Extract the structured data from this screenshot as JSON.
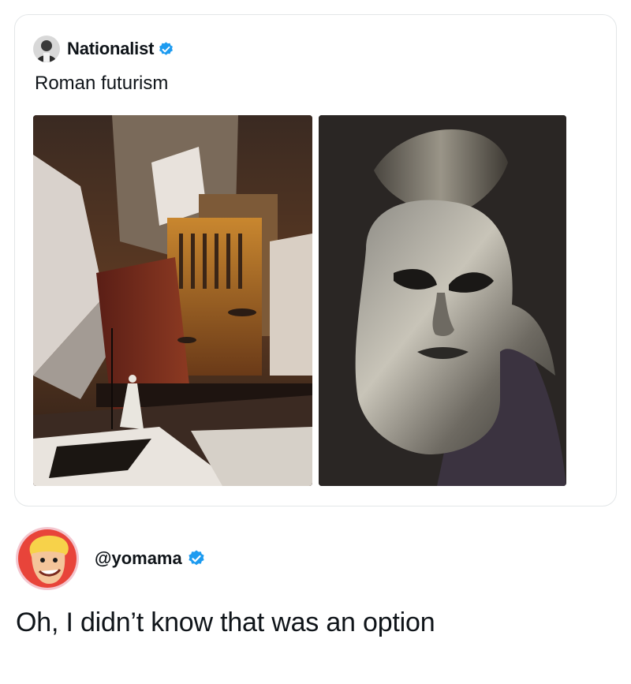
{
  "quoted_post": {
    "author_name": "Nationalist",
    "text": "Roman futurism",
    "media": [
      {
        "kind": "painting",
        "subject": "futuristic-roman-city-art"
      },
      {
        "kind": "photo",
        "subject": "metal-helmet-mask"
      }
    ]
  },
  "reply": {
    "handle": "@yomama",
    "text": "Oh, I didn’t know that was an option"
  },
  "colors": {
    "verified_blue": "#1d9bf0",
    "text": "#0f1419",
    "card_border": "#e3e6e8"
  },
  "icons": [
    "verified-badge-icon",
    "avatar-icon"
  ]
}
